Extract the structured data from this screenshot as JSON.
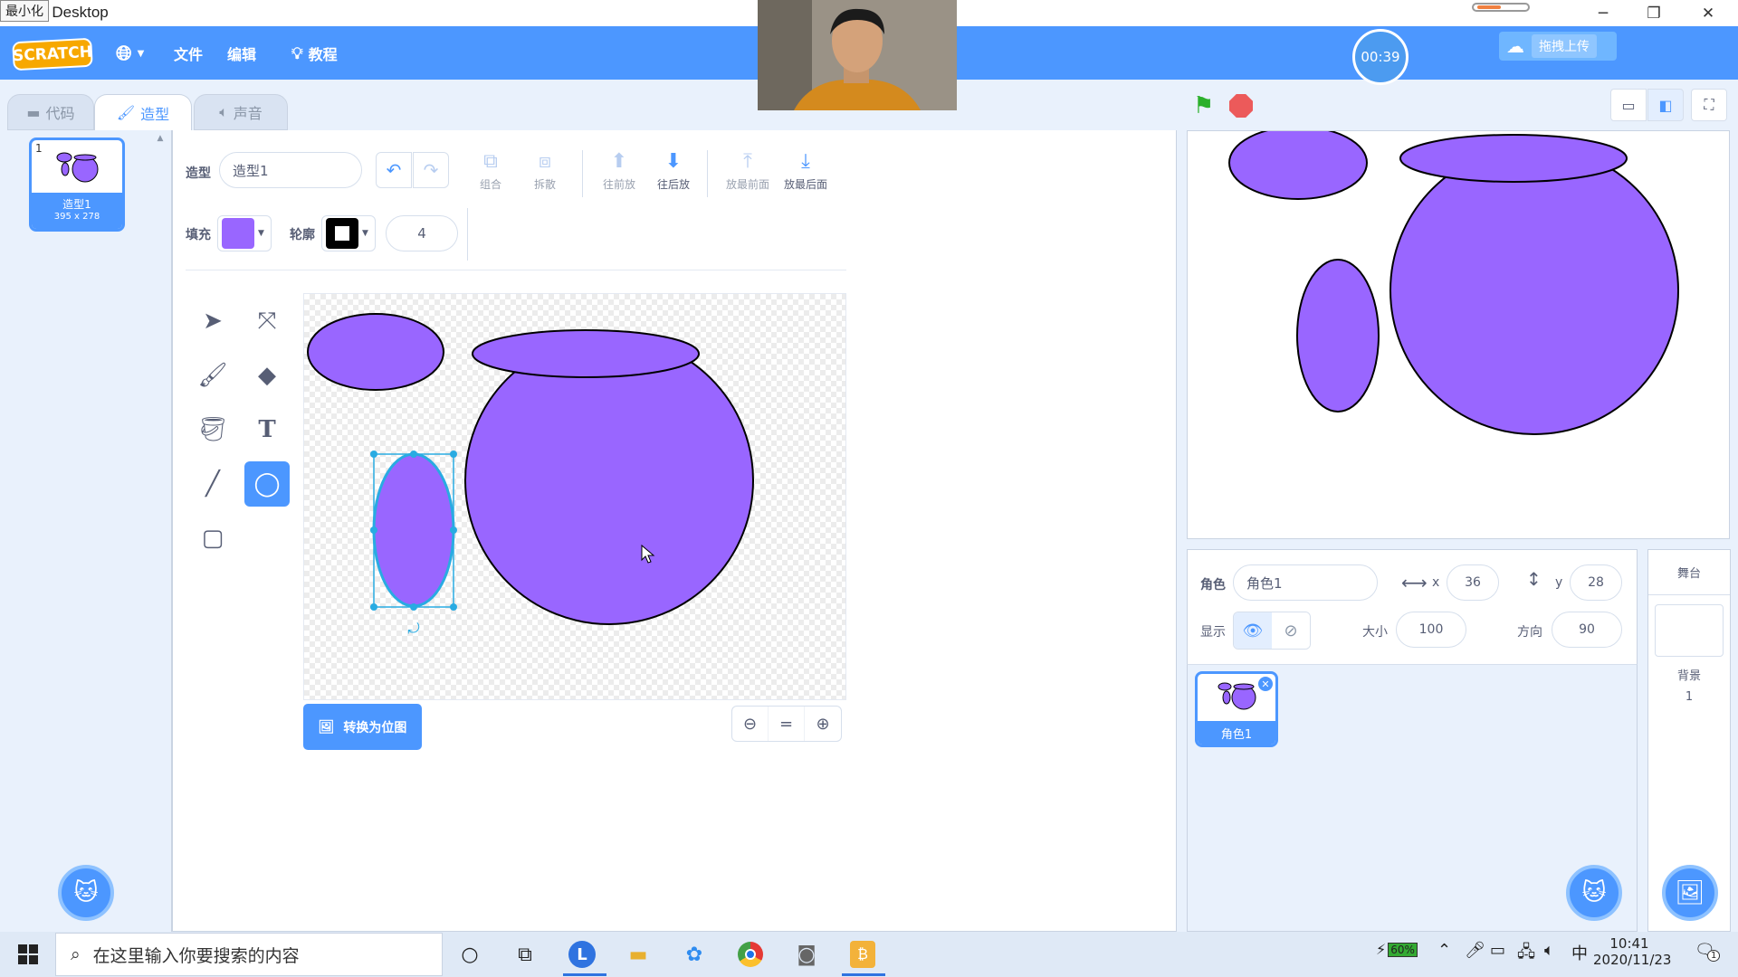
{
  "window": {
    "title": "tch Desktop",
    "tooltip": "最小化"
  },
  "menu": {
    "language_icon": "globe-icon",
    "file": "文件",
    "edit": "编辑",
    "tutorials": "教程",
    "logo": "SCRATCH"
  },
  "timer": "00:39",
  "upload_label": "拖拽上传",
  "tabs": [
    {
      "label": "代码",
      "icon": "code-icon"
    },
    {
      "label": "造型",
      "icon": "brush-icon"
    },
    {
      "label": "声音",
      "icon": "speaker-icon"
    }
  ],
  "costume_card": {
    "index": "1",
    "name": "造型1",
    "size": "395 x 278"
  },
  "costume_editor": {
    "name_label": "造型",
    "name_value": "造型1",
    "group": "组合",
    "ungroup": "拆散",
    "forward": "往前放",
    "backward": "往后放",
    "front": "放最前面",
    "back": "放最后面",
    "fill_label": "填充",
    "fill_color": "#9966ff",
    "outline_label": "轮廓",
    "outline_color": "#000000",
    "outline_width": "4",
    "convert_bitmap": "转换为位图"
  },
  "paint_tools": [
    "select-tool",
    "reshape-tool",
    "brush-tool",
    "eraser-tool",
    "fill-tool",
    "text-tool",
    "line-tool",
    "circle-tool",
    "rectangle-tool"
  ],
  "active_tool": "circle-tool",
  "sprite_info": {
    "sprite_label": "角色",
    "sprite_name": "角色1",
    "x_label": "x",
    "x_value": "36",
    "y_label": "y",
    "y_value": "28",
    "show_label": "显示",
    "size_label": "大小",
    "size_value": "100",
    "direction_label": "方向",
    "direction_value": "90"
  },
  "sprite_card": {
    "name": "角色1"
  },
  "stage_pane": {
    "title": "舞台",
    "backdrop_label": "背景",
    "backdrop_count": "1"
  },
  "taskbar": {
    "search_placeholder": "在这里输入你要搜索的内容",
    "battery": "60%",
    "ime": "中",
    "time": "10:41",
    "date": "2020/11/23",
    "notifications": "1"
  },
  "colors": {
    "accent": "#4c97ff",
    "shape_fill": "#9966ff",
    "selection": "#29abe2"
  }
}
